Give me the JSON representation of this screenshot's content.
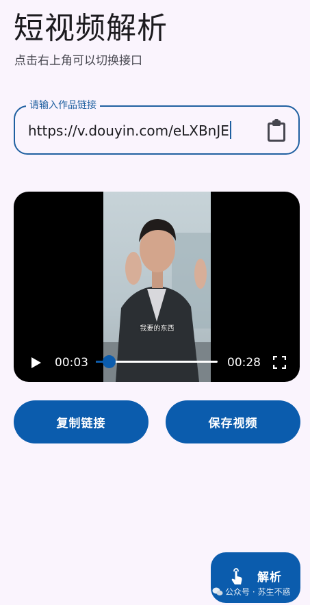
{
  "header": {
    "title": "短视频解析",
    "subtitle": "点击右上角可以切换接口"
  },
  "url_input": {
    "label": "请输入作品链接",
    "value": "https://v.douyin.com/eLXBnJE"
  },
  "video": {
    "subtitle_text": "我要的东西",
    "current_time": "00:03",
    "total_time": "00:28",
    "progress": 0.107
  },
  "buttons": {
    "copy_label": "复制链接",
    "save_label": "保存视频"
  },
  "fab": {
    "label": "解析"
  },
  "watermark": {
    "text": "公众号 · 苏生不惑"
  },
  "colors": {
    "background": "#faf4fd",
    "primary": "#0b5cad",
    "outline": "#1e5fa0"
  },
  "icons": {
    "paste": "clipboard-icon",
    "play": "play-icon",
    "fullscreen": "fullscreen-icon",
    "parse": "tap-hand-icon"
  }
}
